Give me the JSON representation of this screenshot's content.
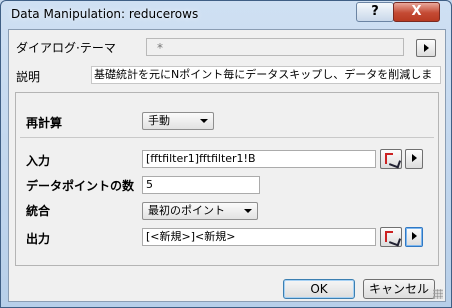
{
  "window": {
    "title": "Data Manipulation: reducerows"
  },
  "titlebar": {
    "help_glyph": "?",
    "close_glyph": "X"
  },
  "dialog_theme": {
    "label": "ダイアログ·テーマ",
    "value": "*"
  },
  "description": {
    "label": "説明",
    "text": "基礎統計を元にNポイント毎にデータスキップし、データを削減しま"
  },
  "recalculate": {
    "label": "再計算",
    "value": "手動"
  },
  "input": {
    "label": "入力",
    "value": "[fftfilter1]fftfilter1!B"
  },
  "data_points": {
    "label": "データポイントの数",
    "value": "5"
  },
  "merge": {
    "label": "統合",
    "value": "最初のポイント"
  },
  "output": {
    "label": "出力",
    "value": "[<新規>]<新規>"
  },
  "buttons": {
    "ok": "OK",
    "cancel": "キャンセル"
  },
  "colors": {
    "title_bar": "#c6d9ee",
    "close_button": "#c44a33",
    "panel_bg": "#f0f0f0"
  }
}
